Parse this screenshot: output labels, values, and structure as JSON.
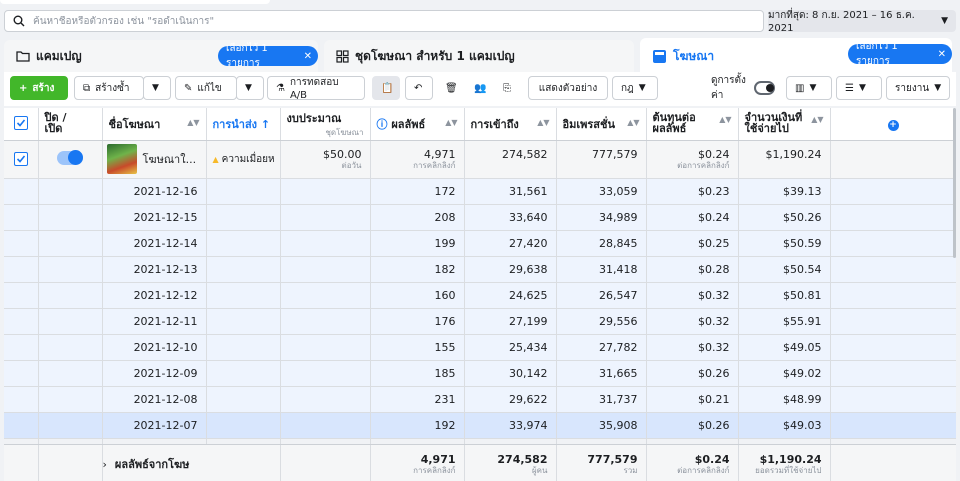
{
  "search": {
    "placeholder": "ค้นหาชื่อหรือตัวกรอง เช่น \"รอดำเนินการ\""
  },
  "date_range": {
    "label": "มากที่สุด: 8 ก.ย. 2021 – 16 ธ.ค. 2021"
  },
  "tabs": [
    {
      "label": "แคมเปญ",
      "icon": "folder-icon"
    },
    {
      "label": "ชุดโฆษณา สำหรับ 1 แคมเปญ",
      "icon": "grid-icon"
    },
    {
      "label": "โฆษณา",
      "icon": "ad-icon"
    }
  ],
  "selection_pills": {
    "campaign": "เลือกไว้ 1 รายการ",
    "ad": "เลือกไว้ 1 รายการ"
  },
  "toolbar": {
    "create": "สร้าง",
    "duplicate": "สร้างซ้ำ",
    "edit": "แก้ไข",
    "ab_test": "การทดสอบ A/B",
    "preview": "แสดงตัวอย่าง",
    "rules": "กฎ",
    "view_setup": "ดูการตั้งค่า",
    "report": "รายงาน"
  },
  "columns": {
    "on_off": "ปิด / เปิด",
    "ad_name": "ชื่อโฆษณา",
    "delivery": "การนำส่ง ↑",
    "budget": "งบประมาณ",
    "budget_sub": "ชุดโฆษณา",
    "results": "ผลลัพธ์",
    "reach": "การเข้าถึง",
    "impressions": "อิมเพรสชั่น",
    "cost_per_result_1": "ต้นทุนต่อ",
    "cost_per_result_2": "ผลลัพธ์",
    "amount_spent_1": "จำนวนเงินที่",
    "amount_spent_2": "ใช้จ่ายไป"
  },
  "ad_row": {
    "name": "โฆษณาใ...",
    "delivery": "ความเมื่อยห",
    "budget": "$50.00",
    "budget_sub": "ต่อวัน",
    "results": "4,971",
    "results_sub": "การคลิกลิงก์",
    "reach": "274,582",
    "impressions": "777,579",
    "cost_per_result": "$0.24",
    "cost_sub": "ต่อการคลิกลิงก์",
    "amount_spent": "$1,190.24"
  },
  "daily_rows": [
    {
      "date": "2021-12-16",
      "results": "172",
      "reach": "31,561",
      "impressions": "33,059",
      "cpr": "$0.23",
      "spent": "$39.13"
    },
    {
      "date": "2021-12-15",
      "results": "208",
      "reach": "33,640",
      "impressions": "34,989",
      "cpr": "$0.24",
      "spent": "$50.26"
    },
    {
      "date": "2021-12-14",
      "results": "199",
      "reach": "27,420",
      "impressions": "28,845",
      "cpr": "$0.25",
      "spent": "$50.59"
    },
    {
      "date": "2021-12-13",
      "results": "182",
      "reach": "29,638",
      "impressions": "31,418",
      "cpr": "$0.28",
      "spent": "$50.54"
    },
    {
      "date": "2021-12-12",
      "results": "160",
      "reach": "24,625",
      "impressions": "26,547",
      "cpr": "$0.32",
      "spent": "$50.81"
    },
    {
      "date": "2021-12-11",
      "results": "176",
      "reach": "27,199",
      "impressions": "29,556",
      "cpr": "$0.32",
      "spent": "$55.91"
    },
    {
      "date": "2021-12-10",
      "results": "155",
      "reach": "25,434",
      "impressions": "27,782",
      "cpr": "$0.32",
      "spent": "$49.05"
    },
    {
      "date": "2021-12-09",
      "results": "185",
      "reach": "30,142",
      "impressions": "31,665",
      "cpr": "$0.26",
      "spent": "$49.02"
    },
    {
      "date": "2021-12-08",
      "results": "231",
      "reach": "29,622",
      "impressions": "31,737",
      "cpr": "$0.21",
      "spent": "$48.99"
    },
    {
      "date": "2021-12-07",
      "results": "192",
      "reach": "33,974",
      "impressions": "35,908",
      "cpr": "$0.26",
      "spent": "$49.03"
    }
  ],
  "totals": {
    "label": "ผลลัพธ์จากโฆษ",
    "results": "4,971",
    "results_sub": "การคลิกลิงก์",
    "reach": "274,582",
    "reach_sub": "ผู้คน",
    "impressions": "777,579",
    "impressions_sub": "รวม",
    "cpr": "$0.24",
    "cpr_sub": "ต่อการคลิกลิงก์",
    "spent": "$1,190.24",
    "spent_sub": "ยอดรวมที่ใช้จ่ายไป"
  },
  "colors": {
    "accent": "#1877f2",
    "create": "#42b72a",
    "row_highlight": "#eef4fe",
    "row_selected": "#d8e6fd"
  }
}
